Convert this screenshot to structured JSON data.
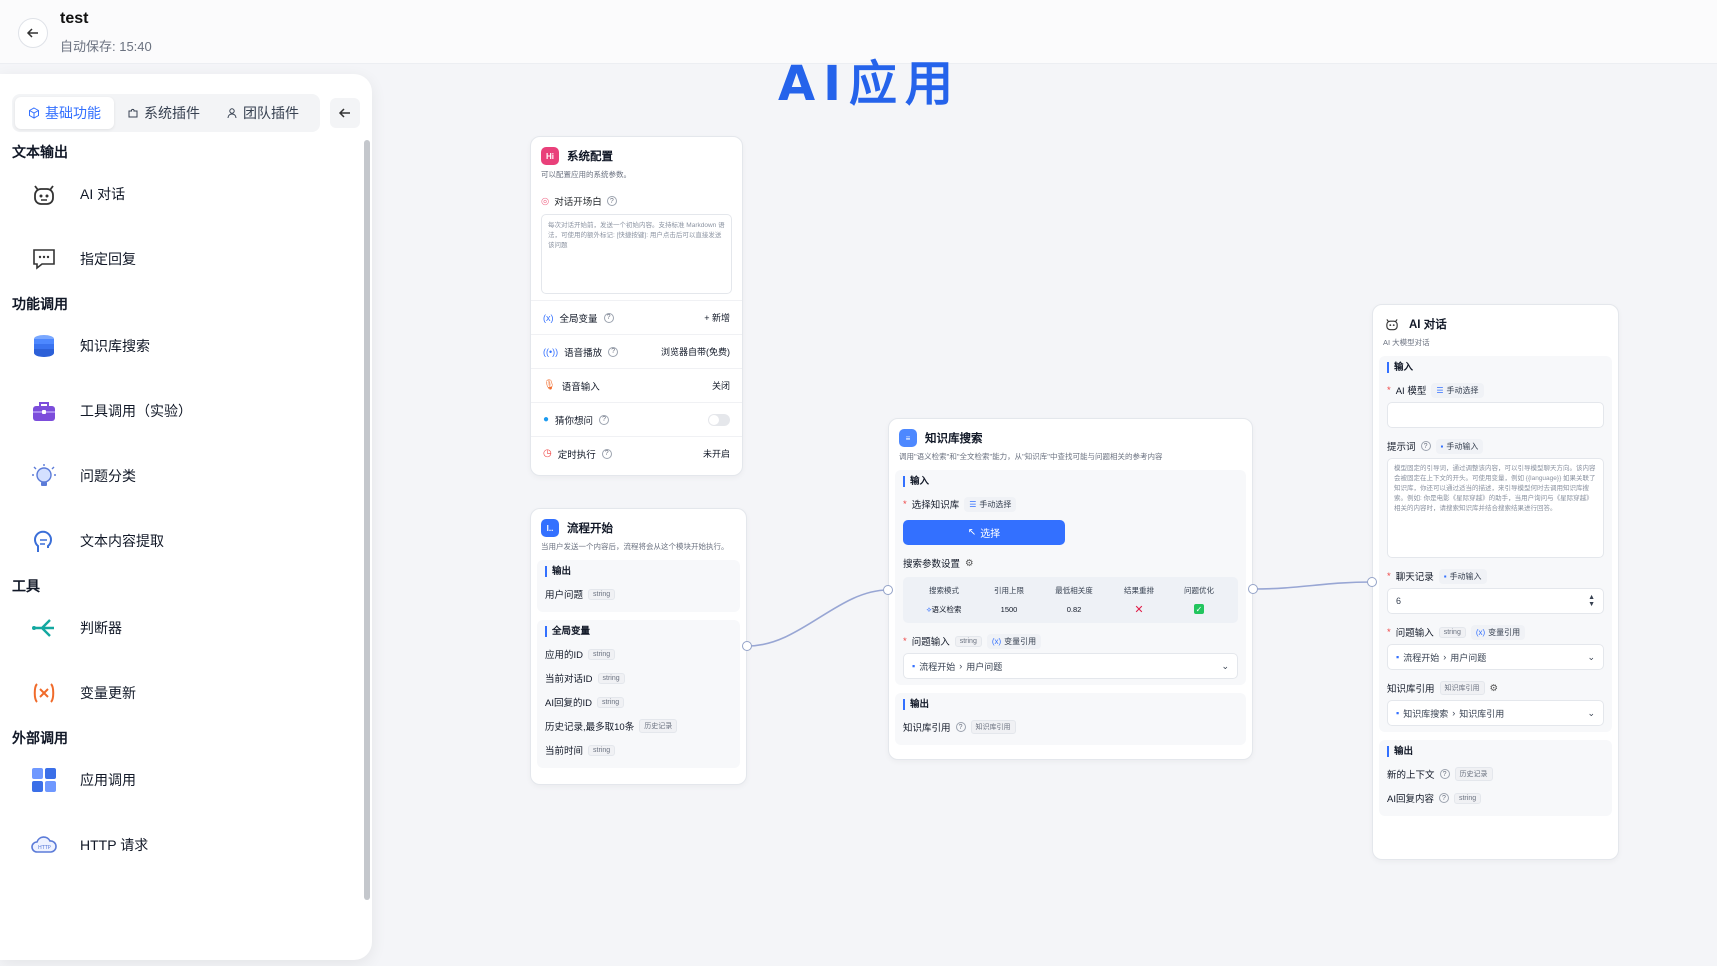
{
  "header": {
    "title": "test",
    "autosave": "自动保存: 15:40"
  },
  "canvas_title": "AI应用",
  "sidebar": {
    "tabs": [
      {
        "label": "基础功能",
        "icon": "cube-icon"
      },
      {
        "label": "系统插件",
        "icon": "puzzle-icon"
      },
      {
        "label": "团队插件",
        "icon": "user-icon"
      }
    ],
    "sections": {
      "text_output": "文本输出",
      "function_call": "功能调用",
      "tools": "工具",
      "external": "外部调用"
    },
    "modules": {
      "ai_chat": "AI 对话",
      "reply": "指定回复",
      "kb_search": "知识库搜索",
      "tool_call": "工具调用（实验）",
      "classify": "问题分类",
      "extract": "文本内容提取",
      "judge": "判断器",
      "var_update": "变量更新",
      "app_call": "应用调用",
      "http": "HTTP 请求"
    }
  },
  "system_config": {
    "title": "系统配置",
    "desc": "可以配置应用的系统参数。",
    "welcome_label": "对话开场白",
    "welcome_placeholder": "每次对话开始前，发送一个初始内容。支持标准 Markdown 语法，可使用的额外标记: [快捷按键]: 用户点击后可以直接发送该问题",
    "global_var": "全局变量",
    "global_var_action": "+ 新增",
    "tts": "语音播放",
    "tts_value": "浏览器自带(免费)",
    "voice_input": "语音输入",
    "voice_input_value": "关闭",
    "guess": "猜你想问",
    "schedule": "定时执行",
    "schedule_value": "未开启"
  },
  "flow_start": {
    "title": "流程开始",
    "desc": "当用户发送一个内容后，流程将会从这个模块开始执行。",
    "output_title": "输出",
    "user_question": "用户问题",
    "string": "string",
    "global_title": "全局变量",
    "app_id": "应用的ID",
    "chat_id": "当前对话ID",
    "reply_id": "AI回复的ID",
    "history": "历史记录,最多取10条",
    "history_tag": "历史记录",
    "time": "当前时间"
  },
  "kb_node": {
    "title": "知识库搜索",
    "desc": "调用\"语义检索\"和\"全文检索\"能力，从\"知识库\"中查找可能与问题相关的参考内容",
    "input_title": "输入",
    "select_kb": "选择知识库",
    "manual_select": "手动选择",
    "select_btn": "选择",
    "search_params": "搜索参数设置",
    "table_headers": [
      "搜索模式",
      "引用上限",
      "最低相关度",
      "结果重排",
      "问题优化"
    ],
    "table_values": [
      "语义检索",
      "1500",
      "0.82"
    ],
    "question_input": "问题输入",
    "string": "string",
    "var_ref": "变量引用",
    "question_value_a": "流程开始",
    "question_value_b": "用户问题",
    "output_title": "输出",
    "kb_ref": "知识库引用",
    "kb_ref_tag": "知识库引用"
  },
  "ai_node": {
    "title": "AI 对话",
    "desc": "AI 大模型对话",
    "input_title": "输入",
    "model": "AI 模型",
    "manual_select": "手动选择",
    "prompt": "提示词",
    "manual_input": "手动输入",
    "prompt_placeholder": "模型固定的引导词，通过调整该内容，可以引导模型聊天方向。该内容会被固定在上下文的开头。可使用变量，例如 {{language}} 如果关联了知识库，你还可以通过适当的描述，来引导模型何时去调用知识库搜索。例如: 你是电影《星际穿越》的助手，当用户询问与《星际穿越》相关的内容时，请搜索知识库并结合搜索结果进行回答。",
    "history": "聊天记录",
    "history_value": "6",
    "question_input": "问题输入",
    "string": "string",
    "var_ref": "变量引用",
    "question_value_a": "流程开始",
    "question_value_b": "用户问题",
    "kb_ref": "知识库引用",
    "kb_ref_tag": "知识库引用",
    "kb_value_a": "知识库搜索",
    "kb_value_b": "知识库引用",
    "output_title": "输出",
    "new_context": "新的上下文",
    "history_tag": "历史记录",
    "reply_content": "AI回复内容"
  },
  "colors": {
    "accent": "#3370ff",
    "title": "#2563eb"
  }
}
